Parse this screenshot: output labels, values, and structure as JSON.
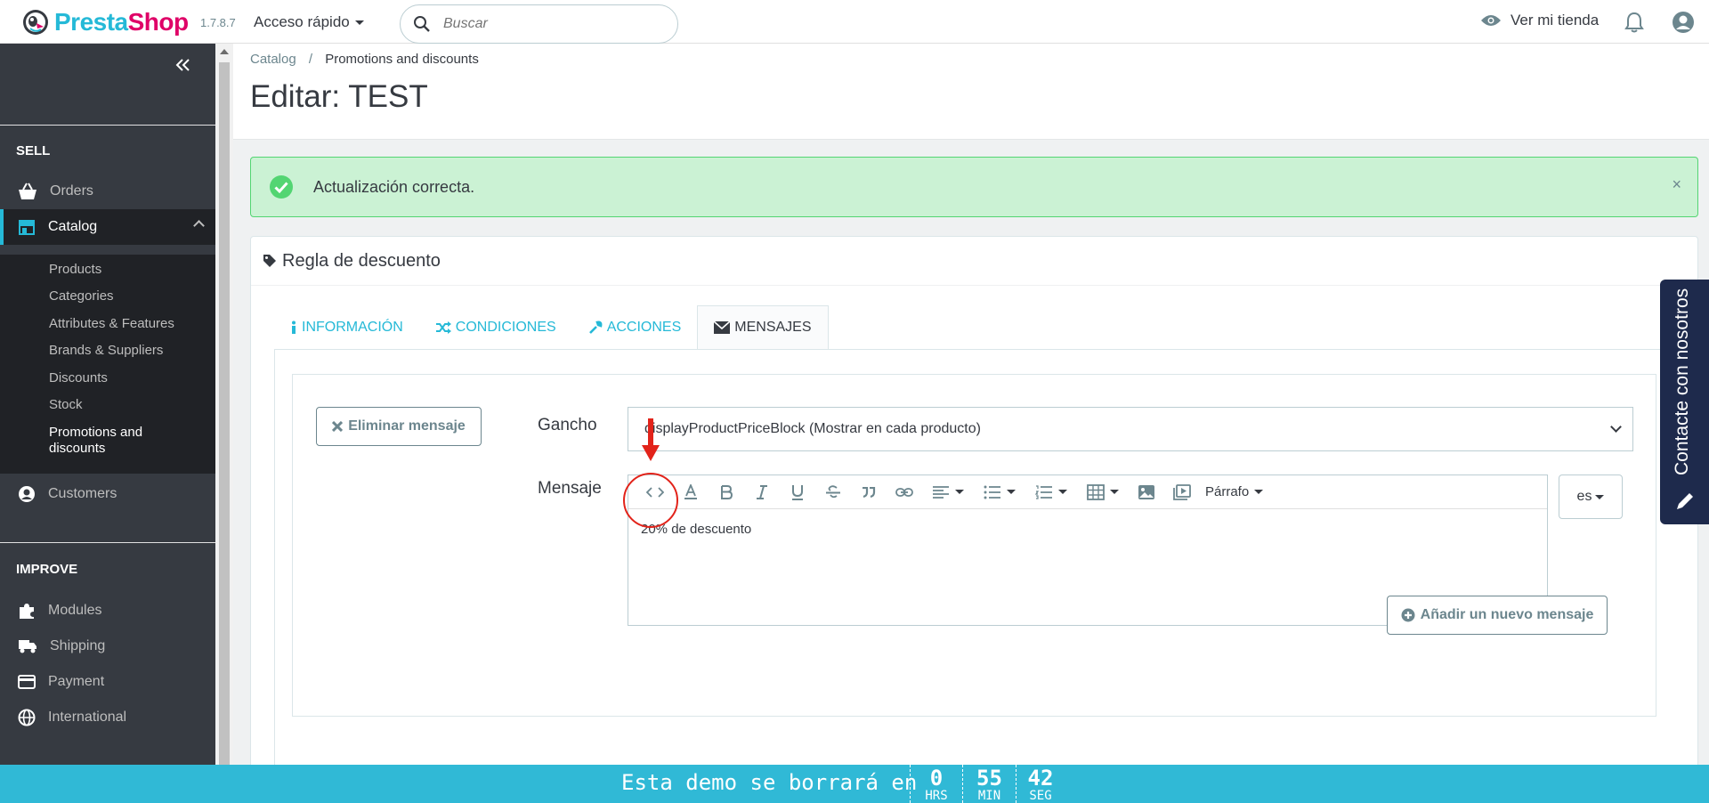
{
  "header": {
    "logo_part1": "Presta",
    "logo_part2": "Shop",
    "version": "1.7.8.7",
    "quick_access": "Acceso rápido",
    "search_placeholder": "Buscar",
    "view_shop": "Ver mi tienda"
  },
  "sidebar": {
    "sell_title": "SELL",
    "improve_title": "IMPROVE",
    "orders": "Orders",
    "catalog": "Catalog",
    "catalog_sub": [
      "Products",
      "Categories",
      "Attributes & Features",
      "Brands & Suppliers",
      "Discounts",
      "Stock",
      "Promotions and",
      "discounts"
    ],
    "customers": "Customers",
    "modules": "Modules",
    "shipping": "Shipping",
    "payment": "Payment",
    "international": "International"
  },
  "breadcrumb": {
    "parent": "Catalog",
    "current": "Promotions and discounts"
  },
  "page_title": "Editar: TEST",
  "alert": {
    "message": "Actualización correcta.",
    "close": "×"
  },
  "panel": {
    "title": "Regla de descuento",
    "tabs": [
      "INFORMACIÓN",
      "CONDICIONES",
      "ACCIONES",
      "MENSAJES"
    ]
  },
  "form": {
    "delete_button": "Eliminar mensaje",
    "hook_label": "Gancho",
    "hook_value": "displayProductPriceBlock (Mostrar en cada producto)",
    "message_label": "Mensaje",
    "paragraph_label": "Párrafo",
    "message_content": "20% de descuento",
    "language": "es",
    "add_button": "Añadir un nuevo mensaje"
  },
  "contact_tab": "Contacte con nosotros",
  "countdown": {
    "text": "Esta demo se borrará en",
    "hours": "0",
    "hours_label": "HRS",
    "minutes": "55",
    "minutes_label": "MIN",
    "seconds": "42",
    "seconds_label": "SEG"
  },
  "colors": {
    "accent": "#25b9d7",
    "brand_pink": "#df0067",
    "sidebar": "#363a41",
    "success_bg": "#cbf2d4",
    "countdown_bg": "#30b9d6",
    "annotation_red": "#e2231a"
  }
}
